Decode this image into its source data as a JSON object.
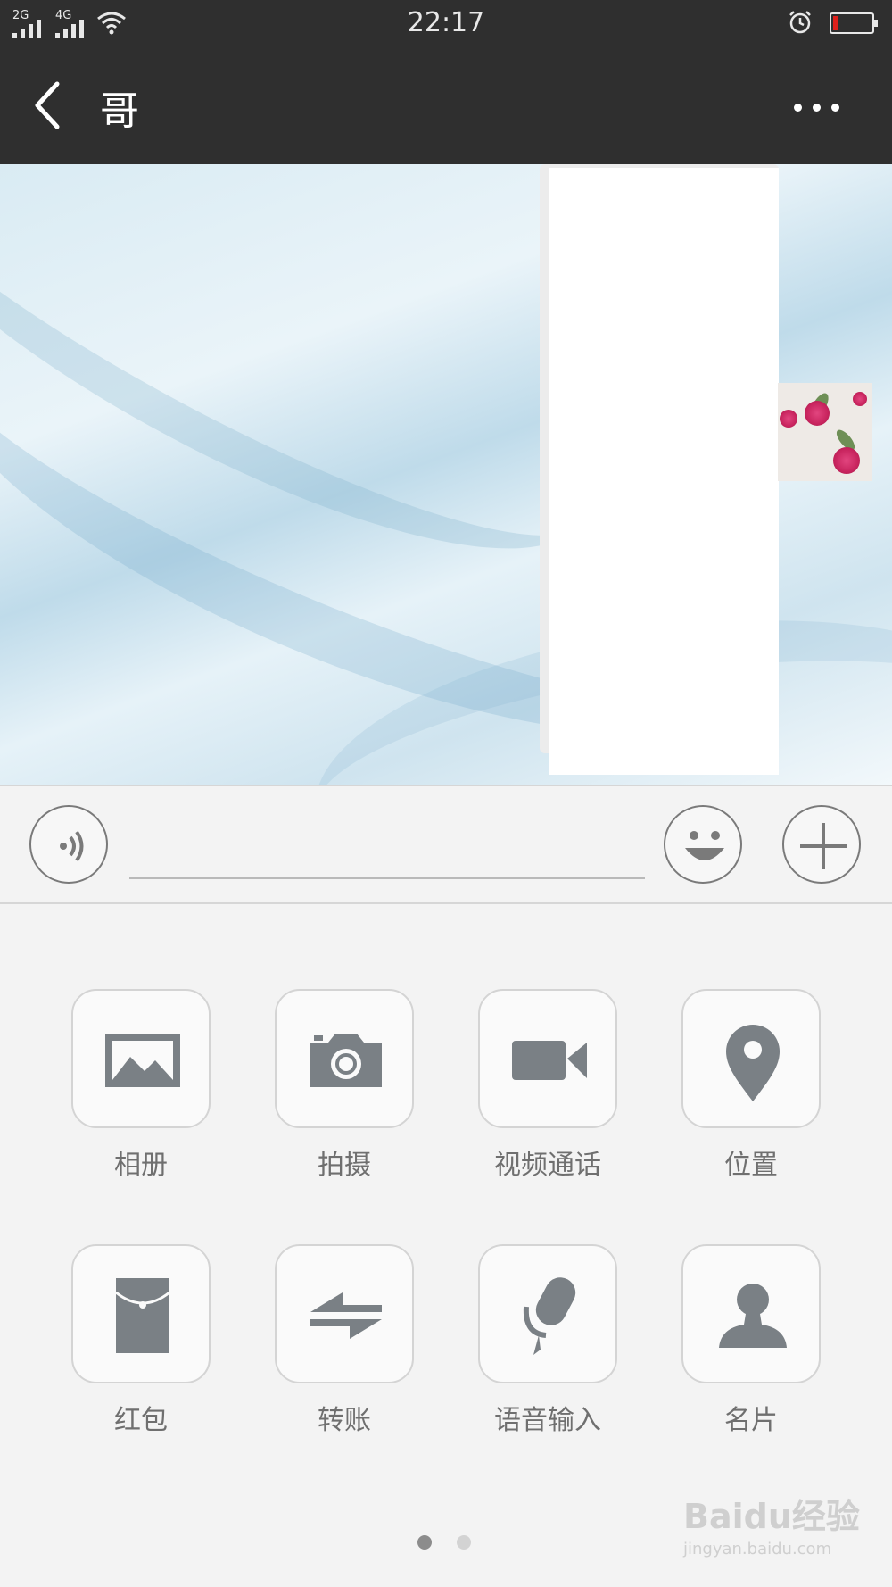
{
  "status_bar": {
    "signal1": "2G",
    "signal2": "4G",
    "time": "22:17",
    "icons": [
      "signal-icon",
      "wifi-icon",
      "alarm-icon",
      "battery-low-icon"
    ],
    "battery_color": "#e0201b"
  },
  "header": {
    "title": "哥",
    "back_icon": "chevron-left-icon",
    "menu_icon": "more-dots-icon",
    "background": "#2f2f2f"
  },
  "input_bar": {
    "voice_icon": "voice-icon",
    "emoji_icon": "emoji-icon",
    "plus_icon": "plus-icon",
    "text_value": ""
  },
  "panel": {
    "items": [
      {
        "label": "相册",
        "icon": "album-icon"
      },
      {
        "label": "拍摄",
        "icon": "camera-icon"
      },
      {
        "label": "视频通话",
        "icon": "video-call-icon"
      },
      {
        "label": "位置",
        "icon": "location-icon"
      },
      {
        "label": "红包",
        "icon": "red-packet-icon"
      },
      {
        "label": "转账",
        "icon": "transfer-icon"
      },
      {
        "label": "语音输入",
        "icon": "microphone-icon"
      },
      {
        "label": "名片",
        "icon": "contact-card-icon"
      }
    ],
    "page_count": 2,
    "current_page": 1
  },
  "watermark": {
    "brand": "Baidu经验",
    "url": "jingyan.baidu.com"
  }
}
